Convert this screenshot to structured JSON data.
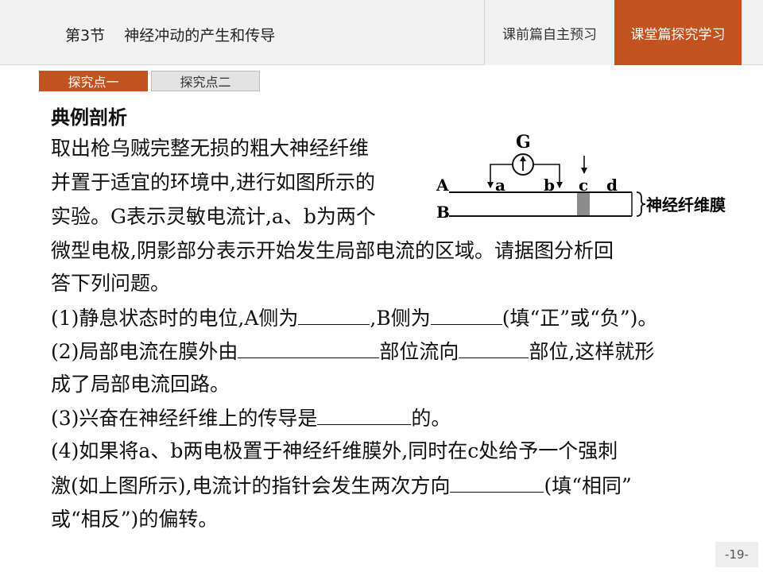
{
  "header": {
    "section_num": "第3节",
    "section_title": "神经冲动的产生和传导",
    "nav_prev": "课前篇自主预习",
    "nav_current": "课堂篇探究学习"
  },
  "tabs": [
    {
      "label": "探究点一",
      "active": true
    },
    {
      "label": "探究点二",
      "active": false
    }
  ],
  "heading": "典例剖析",
  "paragraph": {
    "line1": "取出枪乌贼完整无损的粗大神经纤维",
    "line2": "并置于适宜的环境中,进行如图所示的",
    "line3": "实验。G表示灵敏电流计,a、b为两个",
    "line4": "微型电极,阴影部分表示开始发生局部电流的区域。请据图分析回",
    "line5": "答下列问题。"
  },
  "questions": {
    "q1_a": "(1)静息状态时的电位,A侧为",
    "q1_b": ",B侧为",
    "q1_c": "(填“正”或“负”)。",
    "q2_a": "(2)局部电流在膜外由",
    "q2_b": "部位流向",
    "q2_c": "部位,这样就形",
    "q2_line2": "成了局部电流回路。",
    "q3_a": "(3)兴奋在神经纤维上的传导是",
    "q3_b": "的。",
    "q4_line1": "(4)如果将a、b两电极置于神经纤维膜外,同时在c处给予一个强刺",
    "q4_line2_a": "激(如上图所示),电流计的指针会发生两次方向",
    "q4_line2_b": "(填“相同”",
    "q4_line3": "或“相反”)的偏转。"
  },
  "diagram": {
    "galvanometer": "G",
    "label_A": "A",
    "label_B": "B",
    "label_a": "a",
    "label_b": "b",
    "label_c": "c",
    "label_d": "d",
    "membrane_label": "神经纤维膜"
  },
  "page_number": "-19-"
}
